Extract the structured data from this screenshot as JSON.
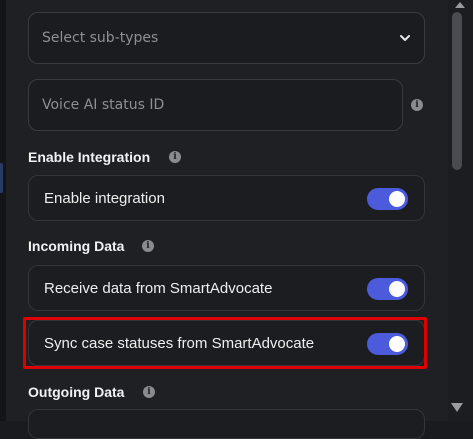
{
  "subtypes": {
    "placeholder": "Select sub-types",
    "chevron_icon": "chevron-down-icon"
  },
  "status_id": {
    "placeholder": "Voice AI status ID",
    "info_icon": "info-icon"
  },
  "enable_integration": {
    "title": "Enable Integration",
    "rows": [
      {
        "label": "Enable integration",
        "on": true
      }
    ]
  },
  "incoming_data": {
    "title": "Incoming Data",
    "rows": [
      {
        "label": "Receive data from SmartAdvocate",
        "on": true
      },
      {
        "label": "Sync case statuses from SmartAdvocate",
        "on": true
      }
    ]
  },
  "outgoing_data": {
    "title": "Outgoing Data"
  },
  "colors": {
    "accent": "#4c5bdc",
    "highlight": "#e00000"
  }
}
